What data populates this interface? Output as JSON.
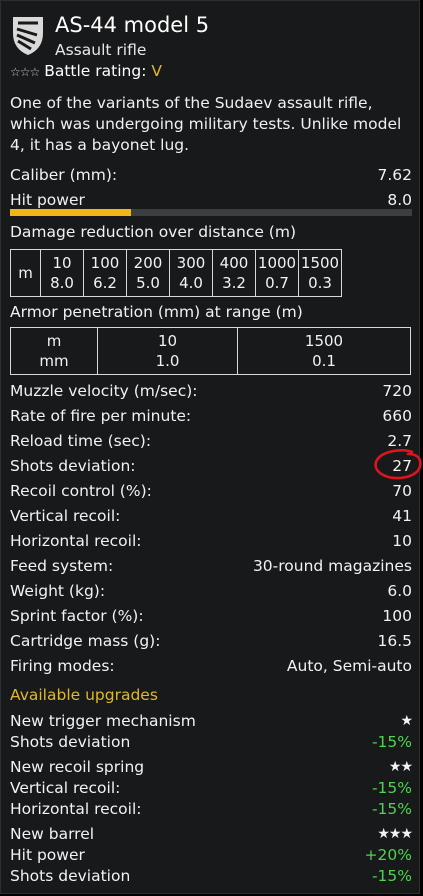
{
  "header": {
    "title": "AS-44 model 5",
    "subtitle": "Assault rifle",
    "rating_stars": "☆☆☆",
    "battle_rating_label": "Battle rating:",
    "battle_rating_value": "V",
    "icon": "assault-rifle-class-icon"
  },
  "description": "One of the variants of the Sudaev assault rifle, which was undergoing military tests. Unlike model 4, it has a bayonet lug.",
  "caliber": {
    "label": "Caliber (mm):",
    "value": "7.62"
  },
  "hit_power": {
    "label": "Hit power",
    "value": "8.0",
    "bar_fraction": 0.3
  },
  "damage_reduction": {
    "title": "Damage reduction over distance (m)",
    "row_label": "m",
    "distances": [
      "10",
      "100",
      "200",
      "300",
      "400",
      "1000",
      "1500"
    ],
    "values": [
      "8.0",
      "6.2",
      "5.0",
      "4.0",
      "3.2",
      "0.7",
      "0.3"
    ]
  },
  "armor_penetration": {
    "title": "Armor penetration (mm) at range (m)",
    "label_top": "m",
    "label_bottom": "mm",
    "ranges": [
      "10",
      "1500"
    ],
    "values": [
      "1.0",
      "0.1"
    ]
  },
  "stats": [
    {
      "label": "Muzzle velocity (m/sec):",
      "value": "720"
    },
    {
      "label": "Rate of fire per minute:",
      "value": "660"
    },
    {
      "label": "Reload time (sec):",
      "value": "2.7"
    },
    {
      "label": "Shots deviation:",
      "value": "27"
    },
    {
      "label": "Recoil control (%):",
      "value": "70"
    },
    {
      "label": "Vertical recoil:",
      "value": "41"
    },
    {
      "label": "Horizontal recoil:",
      "value": "10"
    },
    {
      "label": "Feed system:",
      "value": "30-round magazines"
    },
    {
      "label": "Weight (kg):",
      "value": "6.0"
    },
    {
      "label": "Sprint factor (%):",
      "value": "100"
    },
    {
      "label": "Cartridge mass (g):",
      "value": "16.5"
    },
    {
      "label": "Firing modes:",
      "value": "Auto, Semi-auto"
    }
  ],
  "upgrades": {
    "title": "Available upgrades",
    "items": [
      {
        "label": "New trigger mechanism",
        "stars": "★"
      },
      {
        "label": "Shots deviation",
        "value": "-15%"
      },
      {
        "label": "New recoil spring",
        "stars": "★★"
      },
      {
        "label": "Vertical recoil:",
        "value": "-15%"
      },
      {
        "label": "Horizontal recoil:",
        "value": "-15%"
      },
      {
        "label": "New barrel",
        "stars": "★★★"
      },
      {
        "label": "Hit power",
        "value": "+20%"
      },
      {
        "label": "Shots deviation",
        "value": "-15%"
      }
    ]
  },
  "colors": {
    "panel_bg": "#18191a",
    "accent_gold": "#e0b82a",
    "bar_fill": "#f3b617",
    "positive_green": "#4fd34f",
    "annotation_red": "#e0141e"
  }
}
